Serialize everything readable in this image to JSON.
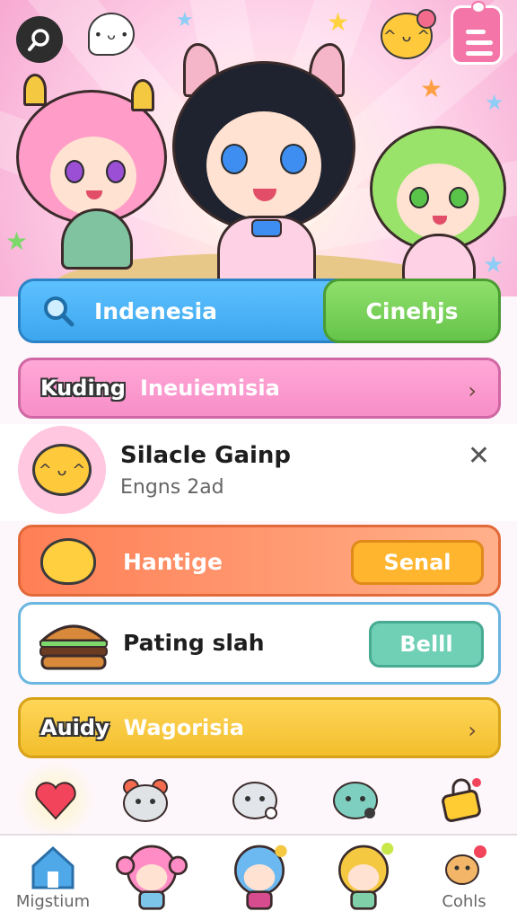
{
  "hero": {
    "icons": [
      "search-icon",
      "ghost-bubble-icon",
      "smile-bubble-icon",
      "document-icon"
    ],
    "characters": [
      "pink-haired-girl",
      "black-haired-catgirl",
      "green-haired-girl"
    ]
  },
  "search": {
    "value": "Indenesia",
    "button_label": "Cinehjs"
  },
  "category1": {
    "tag": "Kuding",
    "label": "Ineuiemisia"
  },
  "notification": {
    "title": "Silacle Gainp",
    "subtitle": "Engns 2ad"
  },
  "promo_orange": {
    "label": "Hantige",
    "button_label": "Senal"
  },
  "promo_white": {
    "label": "Pating slah",
    "button_label": "Belll"
  },
  "category2": {
    "tag": "Auidy",
    "label": "Wagorisia"
  },
  "icon_strip": [
    "heart-icon",
    "bear-face-icon",
    "ghost-face-icon",
    "slime-face-icon",
    "lock-icon"
  ],
  "tabbar": {
    "items": [
      {
        "label": "Migstium",
        "icon": "home-icon"
      },
      {
        "label": "",
        "icon": "chara-pink-icon"
      },
      {
        "label": "",
        "icon": "chara-blue-icon"
      },
      {
        "label": "",
        "icon": "chara-blonde-icon"
      },
      {
        "label": "Cohls",
        "icon": "mascot-icon"
      }
    ]
  },
  "colors": {
    "accent_blue": "#3ca6ee",
    "accent_green": "#66c44a",
    "accent_pink": "#f78ec8",
    "accent_orange": "#ff7f55",
    "accent_yellow": "#f2be2c",
    "accent_teal": "#6fd0b6"
  }
}
